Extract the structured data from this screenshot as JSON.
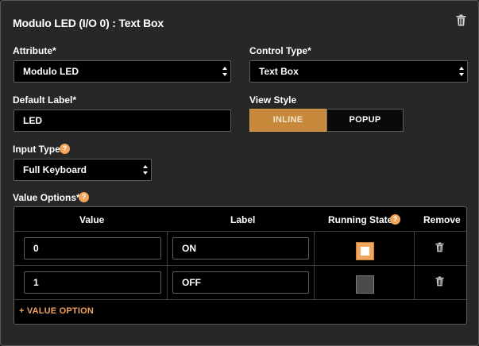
{
  "panel": {
    "title": "Modulo LED (I/O 0) : Text Box"
  },
  "attribute": {
    "label": "Attribute*",
    "value": "Modulo LED"
  },
  "control_type": {
    "label": "Control Type*",
    "value": "Text Box"
  },
  "default_label": {
    "label": "Default Label*",
    "value": "LED"
  },
  "view_style": {
    "label": "View Style",
    "options": [
      "INLINE",
      "POPUP"
    ],
    "selected": "INLINE"
  },
  "input_type": {
    "label": "Input Type",
    "value": "Full Keyboard",
    "help": "?"
  },
  "value_options": {
    "label": "Value Options*",
    "help": "?",
    "columns": {
      "value": "Value",
      "label": "Label",
      "running_state": "Running State",
      "remove": "Remove"
    },
    "rows": [
      {
        "value": "0",
        "label": "ON",
        "running_state": true
      },
      {
        "value": "1",
        "label": "OFF",
        "running_state": false
      }
    ],
    "add_label": "+ VALUE OPTION"
  },
  "colors": {
    "accent": "#f0a55c",
    "panel_bg": "#272727",
    "field_bg": "#000000",
    "border": "#5c5c5c"
  }
}
